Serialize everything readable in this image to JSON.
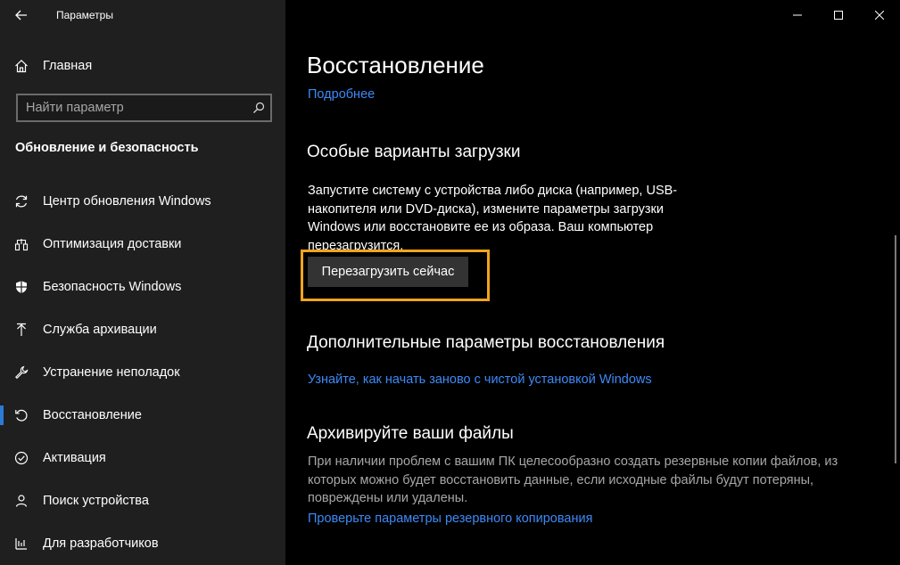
{
  "app": {
    "title": "Параметры"
  },
  "sidebar": {
    "home_label": "Главная",
    "search_placeholder": "Найти параметр",
    "section_title": "Обновление и безопасность",
    "items": [
      {
        "label": "Центр обновления Windows",
        "icon": "refresh-icon"
      },
      {
        "label": "Оптимизация доставки",
        "icon": "delivery-icon"
      },
      {
        "label": "Безопасность Windows",
        "icon": "shield-icon"
      },
      {
        "label": "Служба архивации",
        "icon": "upload-arrow-icon"
      },
      {
        "label": "Устранение неполадок",
        "icon": "wrench-icon"
      },
      {
        "label": "Восстановление",
        "icon": "recovery-icon",
        "active": true
      },
      {
        "label": "Активация",
        "icon": "check-circle-icon"
      },
      {
        "label": "Поиск устройства",
        "icon": "person-pin-icon"
      },
      {
        "label": "Для разработчиков",
        "icon": "developer-icon"
      }
    ]
  },
  "main": {
    "title": "Восстановление",
    "more_link": "Подробнее",
    "advanced_startup": {
      "heading": "Особые варианты загрузки",
      "line1": "Запустите систему с устройства либо диска (например, USB-",
      "line2": "накопителя или DVD-диска), измените параметры загрузки",
      "line3": "Windows или восстановите ее из образа. Ваш компьютер",
      "line4": "перезагрузится.",
      "button": "Перезагрузить сейчас"
    },
    "more_recovery": {
      "heading": "Дополнительные параметры восстановления",
      "link": "Узнайте, как начать заново с чистой установкой Windows"
    },
    "backup": {
      "heading": "Архивируйте ваши файлы",
      "line1": "При наличии проблем с вашим ПК целесообразно создать резервные копии файлов, из",
      "line2": "которых можно будет восстановить данные, если исходные файлы будут потеряны,",
      "line3": "повреждены или удалены.",
      "link": "Проверьте параметры резервного копирования"
    }
  },
  "colors": {
    "accent": "#2b7bd6",
    "link": "#3d8af7",
    "highlight": "#f1a41b"
  }
}
